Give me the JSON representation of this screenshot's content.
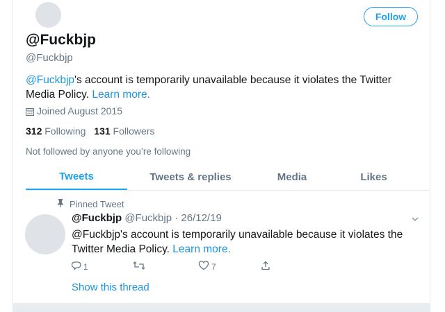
{
  "header": {
    "follow_label": "Follow"
  },
  "profile": {
    "display_name": "@Fuckbjp",
    "handle": "@Fuckbjp",
    "notice_handle": "@Fuckbjp",
    "notice_text": "'s account is temporarily unavailable because it violates the Twitter Media Policy. ",
    "notice_link": "Learn more.",
    "joined": "Joined August 2015",
    "following_count": "312",
    "following_label": "Following",
    "followers_count": "131",
    "followers_label": "Followers",
    "not_followed": "Not followed by anyone you’re following"
  },
  "tabs": [
    {
      "label": "Tweets",
      "active": true
    },
    {
      "label": "Tweets & replies",
      "active": false
    },
    {
      "label": "Media",
      "active": false
    },
    {
      "label": "Likes",
      "active": false
    }
  ],
  "tweet": {
    "pinned_label": "Pinned Tweet",
    "name": "@Fuckbjp",
    "handle_date": "@Fuckbjp · 26/12/19",
    "text": "@Fuckbjp's account is temporarily unavailable because it violates the Twitter Media Policy. ",
    "link": "Learn more.",
    "reply_count": "1",
    "retweet_count": "",
    "like_count": "7",
    "show_thread": "Show this thread"
  },
  "icons": [
    "calendar-icon",
    "pin-icon",
    "chevron-down-icon",
    "reply-icon",
    "retweet-icon",
    "like-icon",
    "share-icon"
  ],
  "colors": {
    "accent": "#1da1f2",
    "link": "#1b95e0",
    "muted": "#657786",
    "text": "#14171a"
  }
}
